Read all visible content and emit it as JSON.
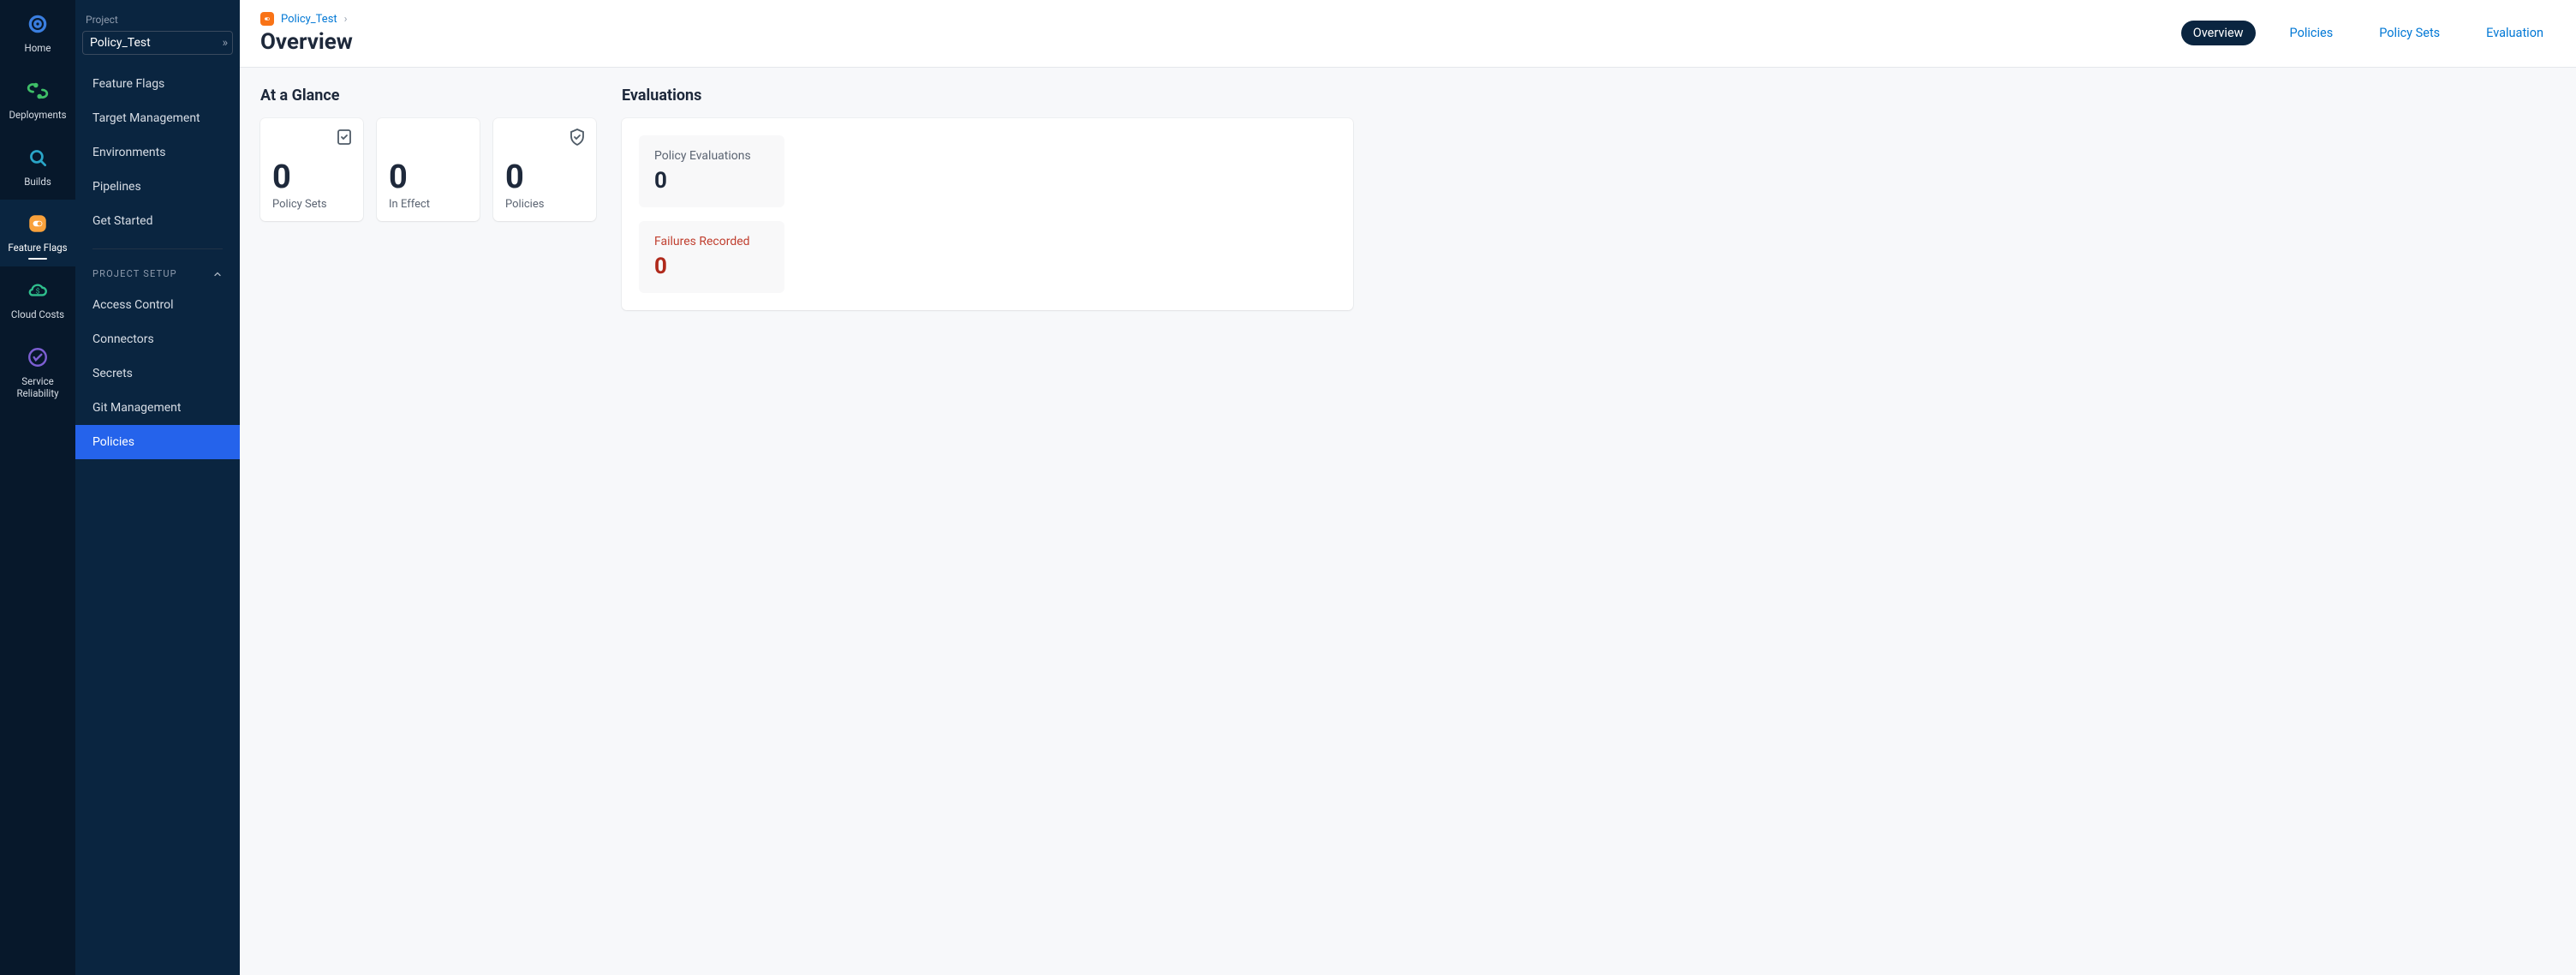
{
  "iconRail": [
    {
      "id": "home",
      "label": "Home",
      "iconColor": "#3a7ee0"
    },
    {
      "id": "deployments",
      "label": "Deployments",
      "iconColor": "#3fbf68"
    },
    {
      "id": "builds",
      "label": "Builds",
      "iconColor": "#2aa6c8"
    },
    {
      "id": "feature-flags",
      "label": "Feature Flags",
      "iconColor": "#f9a13b",
      "active": true
    },
    {
      "id": "cloud-costs",
      "label": "Cloud Costs",
      "iconColor": "#2fbf8d"
    },
    {
      "id": "service-reliability",
      "label": "Service\nReliability",
      "iconColor": "#7d5fd3"
    }
  ],
  "sidebar": {
    "projectLabel": "Project",
    "projectName": "Policy_Test",
    "primaryItems": [
      {
        "label": "Feature Flags"
      },
      {
        "label": "Target Management"
      },
      {
        "label": "Environments"
      },
      {
        "label": "Pipelines"
      },
      {
        "label": "Get Started"
      }
    ],
    "setupHeader": "PROJECT SETUP",
    "setupItems": [
      {
        "label": "Access Control"
      },
      {
        "label": "Connectors"
      },
      {
        "label": "Secrets"
      },
      {
        "label": "Git Management"
      },
      {
        "label": "Policies",
        "active": true
      }
    ]
  },
  "header": {
    "breadcrumbProject": "Policy_Test",
    "title": "Overview",
    "tabs": [
      {
        "label": "Overview",
        "active": true
      },
      {
        "label": "Policies"
      },
      {
        "label": "Policy Sets"
      },
      {
        "label": "Evaluation"
      }
    ]
  },
  "glance": {
    "title": "At a Glance",
    "cards": [
      {
        "value": "0",
        "label": "Policy Sets",
        "icon": "doc-check"
      },
      {
        "value": "0",
        "label": "In Effect",
        "icon": ""
      },
      {
        "value": "0",
        "label": "Policies",
        "icon": "shield-check"
      }
    ]
  },
  "evaluations": {
    "title": "Evaluations",
    "items": [
      {
        "label": "Policy Evaluations",
        "value": "0",
        "variant": "normal"
      },
      {
        "label": "Failures Recorded",
        "value": "0",
        "variant": "fail"
      }
    ]
  }
}
